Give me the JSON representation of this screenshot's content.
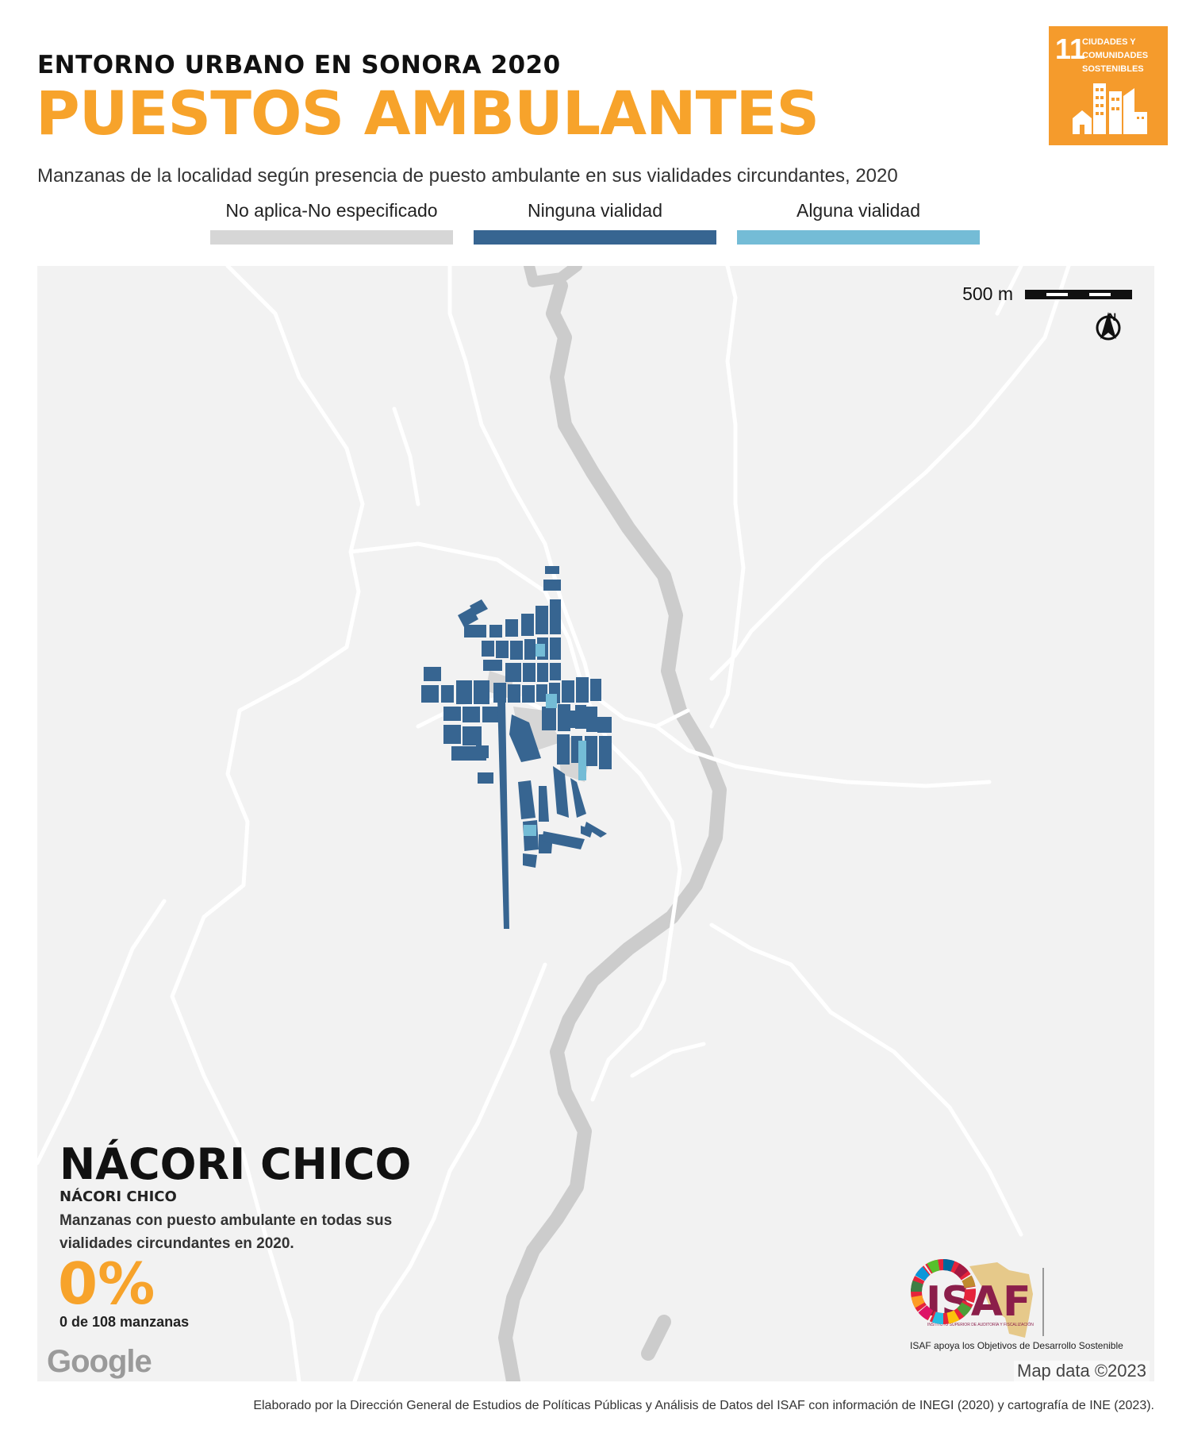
{
  "header": {
    "supertitle": "ENTORNO URBANO EN SONORA 2020",
    "title": "PUESTOS AMBULANTES",
    "subtitle": "Manzanas de la localidad según presencia de puesto ambulante en sus vialidades circundantes, 2020"
  },
  "sdg_badge": {
    "number": "11",
    "label": "CIUDADES Y COMUNIDADES SOSTENIBLES",
    "color": "#f59b2c",
    "icon": "city-buildings-icon"
  },
  "legend": [
    {
      "label": "No aplica-No especificado",
      "color": "#d6d6d6"
    },
    {
      "label": "Ninguna vialidad",
      "color": "#376591"
    },
    {
      "label": "Alguna vialidad",
      "color": "#74bcd6"
    }
  ],
  "map": {
    "scale_label": "500 m",
    "north_label": "N",
    "attribution": "Map data ©2023",
    "provider": "Google",
    "colors": {
      "background": "#f2f2f2",
      "roads": "#ffffff",
      "river": "#cccccc",
      "blocks_none": "#376591",
      "blocks_some": "#74bcd6",
      "blocks_na": "#d6d6d6"
    }
  },
  "locality": {
    "municipality": "NÁCORI CHICO",
    "locality": "NÁCORI CHICO",
    "description": "Manzanas con puesto ambulante en todas sus vialidades circundantes en 2020.",
    "percent": "0%",
    "count_text": "0 de 108 manzanas",
    "percent_value": 0,
    "blocks_with": 0,
    "blocks_total": 108
  },
  "branding": {
    "isaf_logo": "ISAF",
    "isaf_small": "INSTITUTO SUPERIOR DE AUDITORÍA Y FISCALIZACIÓN",
    "isaf_tagline": "ISAF apoya los Objetivos de Desarrollo Sostenible"
  },
  "footer": "Elaborado por la Dirección General de Estudios de Políticas Públicas y Análisis de Datos del ISAF con información de INEGI (2020) y cartografía de INE (2023)."
}
